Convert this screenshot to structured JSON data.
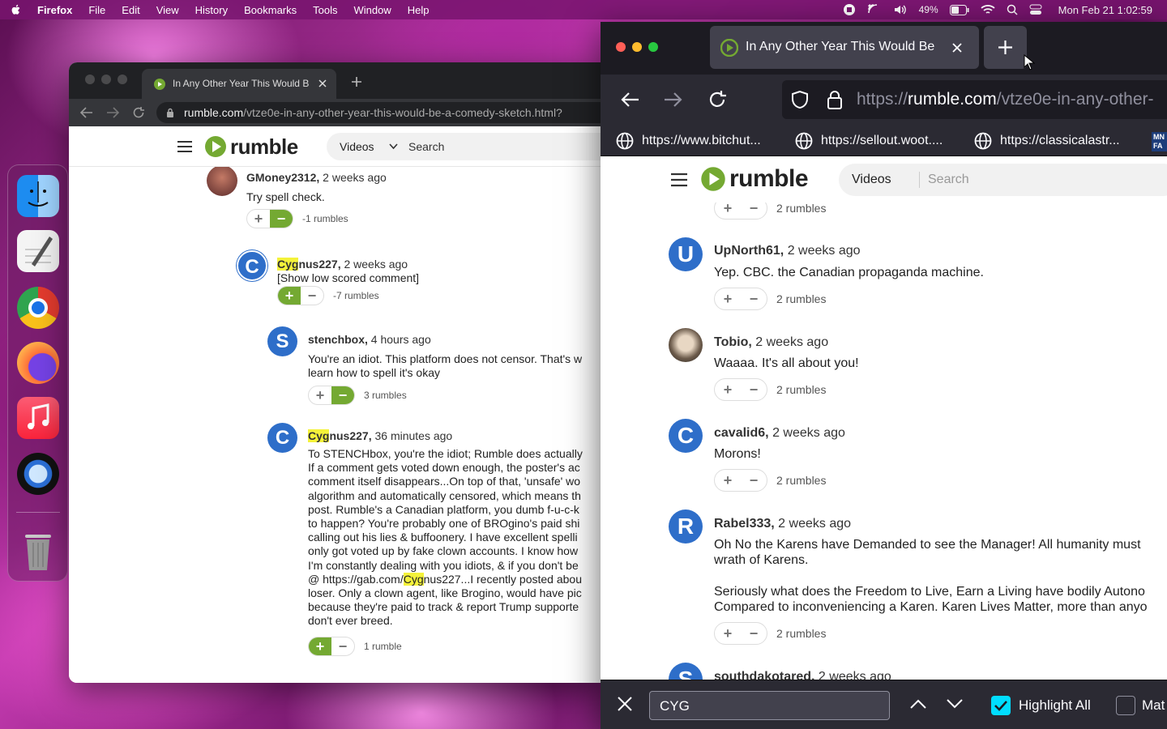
{
  "menubar": {
    "app": "Firefox",
    "items": [
      "File",
      "Edit",
      "View",
      "History",
      "Bookmarks",
      "Tools",
      "Window",
      "Help"
    ],
    "battery": "49%",
    "datetime": "Mon Feb 21  1:02:59"
  },
  "left_window": {
    "tab_title": "In Any Other Year This Would Be",
    "url_domain": "rumble.com",
    "url_path": "/vtze0e-in-any-other-year-this-would-be-a-comedy-sketch.html?",
    "select_value": "Videos",
    "search_placeholder": "Search",
    "comments": {
      "c1": {
        "name": "GMoney2312,",
        "time": "2 weeks ago",
        "text": "Try spell check.",
        "rumbles": "-1 rumbles"
      },
      "c2": {
        "name_hl": "Cyg",
        "name_rest": "nus227,",
        "time": "2 weeks ago",
        "text": "[Show low scored comment]",
        "rumbles": "-7 rumbles",
        "avatar": "C"
      },
      "c3": {
        "name": "stenchbox,",
        "time": "4 hours ago",
        "line1": "You're an idiot. This platform does not censor. That's w",
        "line2": "learn how to spell it's okay",
        "rumbles": "3 rumbles",
        "avatar": "S"
      },
      "c4": {
        "name_hl": "Cyg",
        "name_rest": "nus227,",
        "time": "36 minutes ago",
        "avatar": "C",
        "rumbles": "1 rumble",
        "lines": [
          "To STENCHbox, you're the idiot; Rumble does actually",
          "If a comment gets voted down enough, the poster's ac",
          "comment itself disappears...On top of that, 'unsafe' wo",
          "algorithm and automatically censored, which means th",
          "post. Rumble's a Canadian platform, you dumb f-u-c-k",
          "to happen? You're probably one of BROgino's paid shi",
          "calling out his lies & buffoonery. I have excellent spelli",
          "only got voted up by fake clown accounts. I know how",
          "I'm constantly dealing with you idiots, & if you don't be"
        ],
        "link_pre": "@ https://gab.com/",
        "link_hl": "Cyg",
        "link_post": "nus227...I recently posted abou",
        "lines2": [
          "loser. Only a clown agent, like Brogino, would have pic",
          "because they're paid to track & report Trump supporte",
          "don't ever breed."
        ]
      }
    }
  },
  "right_window": {
    "tab_title": "In Any Other Year This Would Be",
    "url_prefix": "https://",
    "url_domain": "rumble.com",
    "url_path": "/vtze0e-in-any-other-",
    "bookmarks": [
      "https://www.bitchut...",
      "https://sellout.woot....",
      "https://classicalastr..."
    ],
    "bookmark_badge": "MN FA",
    "select_value": "Videos",
    "search_placeholder": "Search",
    "top_rumbles": "2 rumbles",
    "comments": {
      "c1": {
        "name": "UpNorth61,",
        "time": "2 weeks ago",
        "text": "Yep. CBC. the Canadian propaganda machine.",
        "rumbles": "2 rumbles",
        "avatar": "U"
      },
      "c2": {
        "name": "Tobio,",
        "time": "2 weeks ago",
        "text": "Waaaa. It's all about you!",
        "rumbles": "2 rumbles"
      },
      "c3": {
        "name": "cavalid6,",
        "time": "2 weeks ago",
        "text": "Morons!",
        "rumbles": "2 rumbles",
        "avatar": "C"
      },
      "c4": {
        "name": "Rabel333,",
        "time": "2 weeks ago",
        "avatar": "R",
        "rumbles": "2 rumbles",
        "line1": "Oh No the Karens have Demanded to see the Manager! All humanity must",
        "line2": "wrath of Karens.",
        "line3": "Seriously what does the Freedom to Live, Earn a Living have bodily Autono",
        "line4": "Compared to inconveniencing a Karen. Karen Lives Matter, more than anyo"
      },
      "c5": {
        "name": "southdakotared,",
        "time": "2 weeks ago",
        "avatar": "S"
      }
    },
    "findbar": {
      "query": "CYG",
      "highlight_all": "Highlight All",
      "match_case": "Mat"
    }
  },
  "colors": {
    "rumble_green": "#74a932",
    "avatar_blue": "#2e6ec9",
    "highlight": "#f4f23a"
  }
}
